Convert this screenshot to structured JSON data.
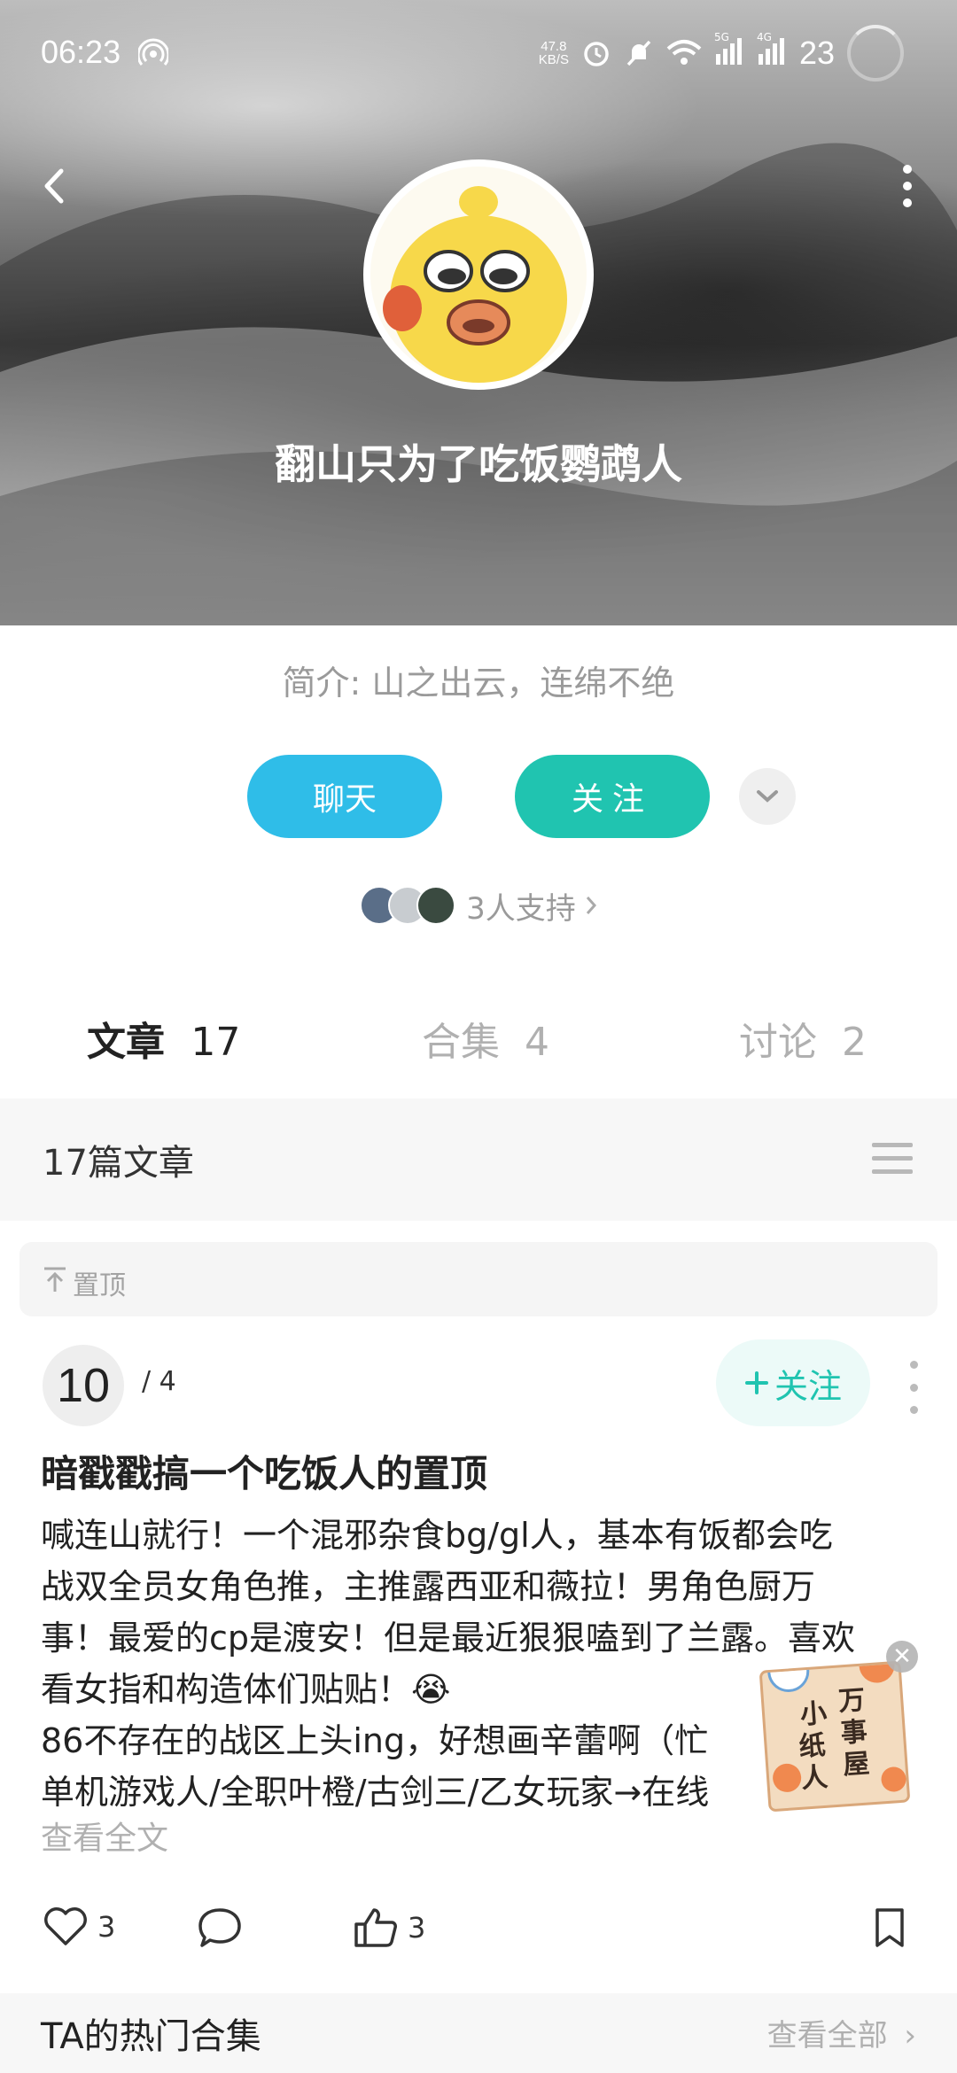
{
  "status_bar": {
    "time": "06:23",
    "net_speed_value": "47.8",
    "net_speed_unit": "KB/S",
    "sim1_label": "5G",
    "sim2_label": "4G",
    "battery": "23"
  },
  "profile": {
    "nickname": "翻山只为了吃饭鹦鹉人",
    "bio": "简介: 山之出云，连绵不绝",
    "chat_label": "聊天",
    "follow_label": "关注",
    "supporters_text": "3人支持"
  },
  "tabs": [
    {
      "label": "文章",
      "count": "17"
    },
    {
      "label": "合集",
      "count": "4"
    },
    {
      "label": "讨论",
      "count": "2"
    }
  ],
  "article_section": {
    "title": "17篇文章",
    "pinned_label": "置顶"
  },
  "post": {
    "number": "10",
    "total": "/ 4",
    "follow_label": "关注",
    "title": "暗戳戳搞一个吃饭人的置顶",
    "body_lines": [
      "喊连山就行！一个混邪杂食bg/gl人，基本有饭都会吃",
      "战双全员女角色推，主推露西亚和薇拉！男角色厨万",
      "事！最爱的cp是渡安！但是最近狠狠嗑到了兰露。喜欢",
      "看女指和构造体们贴贴！😭",
      "86不存在的战区上头ing，好想画辛蕾啊（忙",
      "单机游戏人/全职叶橙/古剑三/乙女玩家→在线"
    ],
    "read_more": "查看全文",
    "like_count": "3",
    "thumb_count": "3"
  },
  "hot_collections": {
    "title": "TA的热门合集",
    "view_all": "查看全部"
  },
  "floating_badge": {
    "chars": [
      "小",
      "万",
      "纸",
      "事",
      "人",
      "屋"
    ]
  },
  "colors": {
    "chat_button": "#2fbde8",
    "follow_button": "#20c4b0"
  }
}
